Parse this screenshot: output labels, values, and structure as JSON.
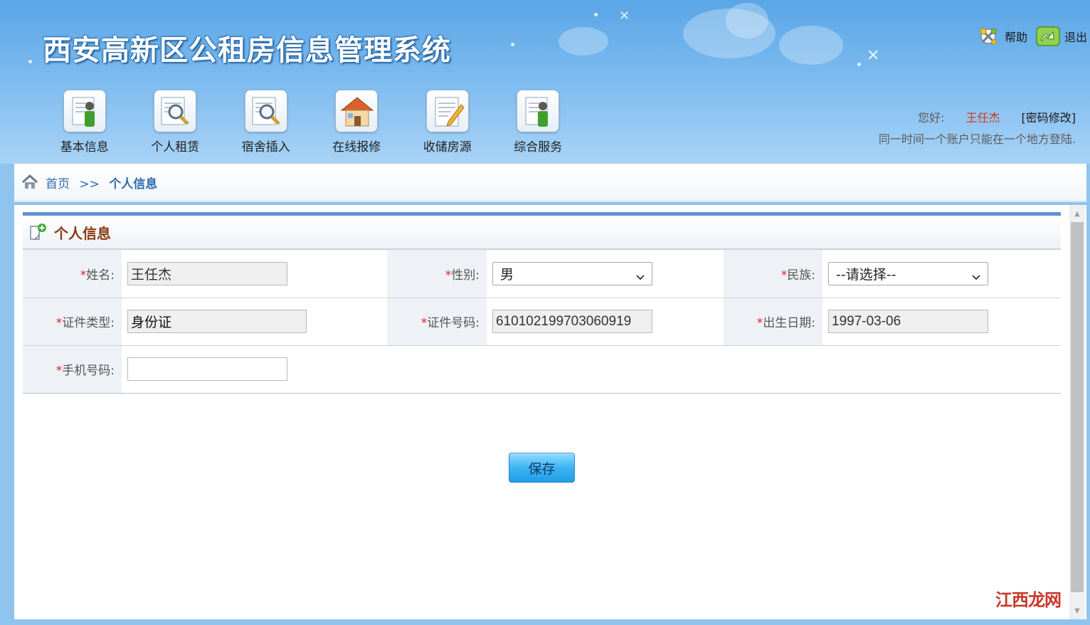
{
  "app": {
    "title": "西安高新区公租房信息管理系统"
  },
  "top_links": {
    "help": "帮助",
    "exit": "退出"
  },
  "nav": {
    "items": [
      {
        "label": "基本信息",
        "icon": "person-doc-icon"
      },
      {
        "label": "个人租赁",
        "icon": "search-doc-icon"
      },
      {
        "label": "宿舍插入",
        "icon": "search-doc-icon"
      },
      {
        "label": "在线报修",
        "icon": "house-icon"
      },
      {
        "label": "收储房源",
        "icon": "pencil-doc-icon"
      },
      {
        "label": "综合服务",
        "icon": "person-doc-icon"
      }
    ]
  },
  "user": {
    "greeting": "您好:",
    "name": "王任杰",
    "change_password": "[密码修改]",
    "notice": "同一时间一个账户只能在一个地方登陆."
  },
  "breadcrumb": {
    "home": "首页",
    "separator": ">>",
    "current": "个人信息"
  },
  "panel": {
    "title": "个人信息"
  },
  "form": {
    "required_mark": "*",
    "name": {
      "label": "姓名:",
      "value": "王任杰"
    },
    "gender": {
      "label": "性别:",
      "value": "男"
    },
    "ethnicity": {
      "label": "民族:",
      "value": "--请选择--"
    },
    "id_type": {
      "label": "证件类型:",
      "value": "身份证"
    },
    "id_number": {
      "label": "证件号码:",
      "value": "610102199703060919"
    },
    "birth_date": {
      "label": "出生日期:",
      "value": "1997-03-06"
    },
    "phone": {
      "label": "手机号码:",
      "value": ""
    }
  },
  "actions": {
    "save": "保存"
  },
  "watermark": {
    "text": "江西龙网"
  },
  "colors": {
    "header_blue": "#5aa6e6",
    "title_brown": "#8a3b12",
    "link_blue": "#2c6db0",
    "user_red": "#d23a1c",
    "required_red": "#e02020",
    "button_blue": "#3fb4f2"
  }
}
